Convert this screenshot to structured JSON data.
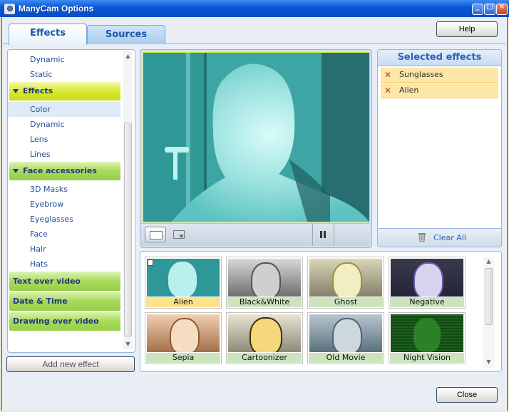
{
  "window": {
    "title": "ManyCam Options"
  },
  "titlebar_buttons": {
    "minimize": "_",
    "maximize": "□",
    "close": "×"
  },
  "tabs": [
    {
      "label": "Effects",
      "active": true
    },
    {
      "label": "Sources",
      "active": false
    }
  ],
  "help_button": "Help",
  "close_button": "Close",
  "sidebar": {
    "items": [
      {
        "type": "item",
        "label": "Dynamic"
      },
      {
        "type": "item",
        "label": "Static"
      },
      {
        "type": "category",
        "label": "Effects",
        "expanded": true,
        "color": "#d9ea2f"
      },
      {
        "type": "item",
        "label": "Color",
        "selected": true
      },
      {
        "type": "item",
        "label": "Dynamic"
      },
      {
        "type": "item",
        "label": "Lens"
      },
      {
        "type": "item",
        "label": "Lines"
      },
      {
        "type": "category",
        "label": "Face accessories",
        "expanded": true,
        "color": "#a8da5b"
      },
      {
        "type": "item",
        "label": "3D Masks"
      },
      {
        "type": "item",
        "label": "Eyebrow"
      },
      {
        "type": "item",
        "label": "Eyeglasses"
      },
      {
        "type": "item",
        "label": "Face"
      },
      {
        "type": "item",
        "label": "Hair"
      },
      {
        "type": "item",
        "label": "Hats"
      },
      {
        "type": "category",
        "label": "Text over video",
        "expanded": false,
        "color": "#a8da5b"
      },
      {
        "type": "category",
        "label": "Date & Time",
        "expanded": false,
        "color": "#a8da5b"
      },
      {
        "type": "category",
        "label": "Drawing over video",
        "expanded": false,
        "color": "#a8da5b"
      }
    ],
    "add_button": "Add new effect"
  },
  "selected_effects": {
    "title": "Selected effects",
    "items": [
      "Sunglasses",
      "Alien"
    ],
    "clear_label": "Clear All"
  },
  "gallery": {
    "tiles": [
      {
        "label": "Alien",
        "selected": true
      },
      {
        "label": "Black&White"
      },
      {
        "label": "Ghost"
      },
      {
        "label": "Negative"
      },
      {
        "label": "Sepia"
      },
      {
        "label": "Cartoonizer"
      },
      {
        "label": "Old Movie"
      },
      {
        "label": "Night Vision"
      }
    ]
  },
  "colors": {
    "accent": "#1a56a6",
    "title_bar": "#0a5ad8",
    "selected_item": "#fde7a6",
    "preview_tint": "#3fb8b4"
  }
}
